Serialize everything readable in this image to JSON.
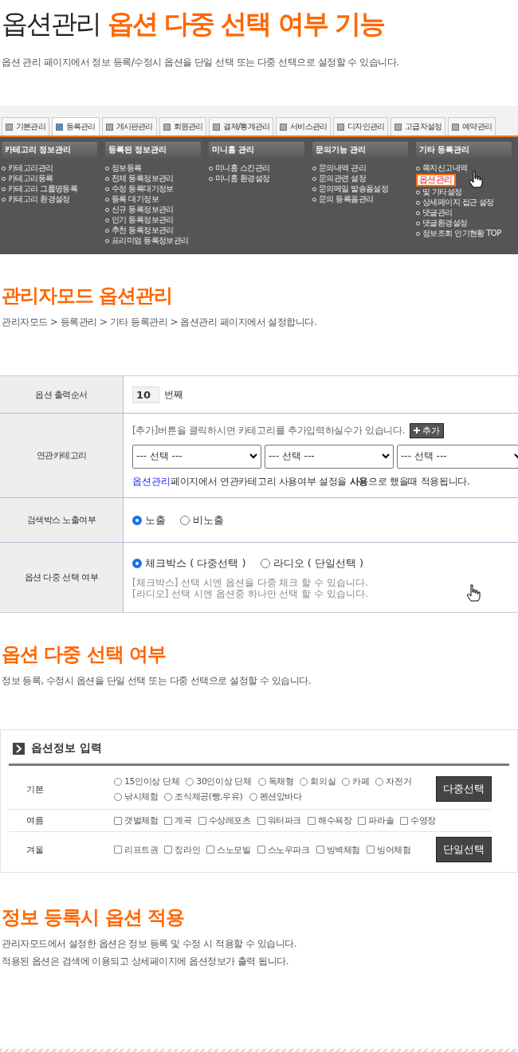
{
  "title": {
    "plain": "옵션관리",
    "accent": "옵션 다중 선택 여부 기능"
  },
  "intro": "옵션 관리 페이지에서 정보 등록/수정시 옵션을 단일 선택 또는 다중 선택으로 설정할 수 있습니다.",
  "admin_menu": {
    "tabs": [
      {
        "label": "기본관리",
        "selected": false
      },
      {
        "label": "등록관리",
        "selected": true
      },
      {
        "label": "게시판관리",
        "selected": false
      },
      {
        "label": "회원관리",
        "selected": false
      },
      {
        "label": "결제/통계관리",
        "selected": false
      },
      {
        "label": "서비스관리",
        "selected": false
      },
      {
        "label": "디자인관리",
        "selected": false
      },
      {
        "label": "고급자설정",
        "selected": false
      },
      {
        "label": "예약관리",
        "selected": false
      }
    ],
    "columns": [
      {
        "heading": "카테고리 정보관리",
        "items": [
          {
            "label": "카테고리관리",
            "selected": false
          },
          {
            "label": "카테고리등록",
            "selected": false
          },
          {
            "label": "카테고리 그룹명등록",
            "selected": false
          },
          {
            "label": "카테고리 환경설정",
            "selected": false
          }
        ]
      },
      {
        "heading": "등록된 정보관리",
        "items": [
          {
            "label": "정보등록",
            "selected": false
          },
          {
            "label": "전체 등록정보관리",
            "selected": false
          },
          {
            "label": "수정 등록대기정보",
            "selected": false
          },
          {
            "label": "등록 대기정보",
            "selected": false
          },
          {
            "label": "신규 등록정보관리",
            "selected": false
          },
          {
            "label": "인기 등록정보관리",
            "selected": false
          },
          {
            "label": "추천 등록정보관리",
            "selected": false
          },
          {
            "label": "프리미엄 등록정보관리",
            "selected": false
          }
        ]
      },
      {
        "heading": "미니홈 관리",
        "items": [
          {
            "label": "미니홈 스킨관리",
            "selected": false
          },
          {
            "label": "미니홈 환경설정",
            "selected": false
          }
        ]
      },
      {
        "heading": "문의기능 관리",
        "items": [
          {
            "label": "문의내역 관리",
            "selected": false
          },
          {
            "label": "문의관련 설정",
            "selected": false
          },
          {
            "label": "문의메일 발송폼설정",
            "selected": false
          },
          {
            "label": "문의 등록폼관리",
            "selected": false
          }
        ]
      },
      {
        "heading": "기타 등록관리",
        "items": [
          {
            "label": "쪽지신고내역",
            "selected": false
          },
          {
            "label": "옵션관리",
            "selected": true
          },
          {
            "label": "및 기타설정",
            "selected": false
          },
          {
            "label": "상세페이지 접근 설정",
            "selected": false
          },
          {
            "label": "댓글관리",
            "selected": false
          },
          {
            "label": "댓글환경설정",
            "selected": false
          },
          {
            "label": "정보조회 인기현황 TOP",
            "selected": false
          }
        ]
      }
    ]
  },
  "section1": {
    "heading": "관리자모드 옵션관리",
    "text": "관리자모드 > 등록관리 > 기타 등록관리 > 옵션관리 페이지에서 설정합니다."
  },
  "settings": [
    {
      "kind": "number",
      "label": "옵션 출력순서",
      "value": "10",
      "unit": "번째"
    },
    {
      "kind": "category",
      "label": "연관카테고리",
      "hint": "[추가]버튼을 클릭하시면 카테고리를 추가입력하실수가 있습니다.",
      "button": "추가",
      "selects": [
        "--- 선택 ---",
        "--- 선택 ---",
        "--- 선택 ---"
      ],
      "note_link": "옵션관리",
      "note": " 페이지에서 연관카테고리 사용여부 설정을 **사용**으로 했을때 적용됩니다."
    },
    {
      "kind": "radio",
      "label": "검색박스 노출여부",
      "options": [
        {
          "label": "노출",
          "selected": true
        },
        {
          "label": "비노출",
          "selected": false
        }
      ]
    },
    {
      "kind": "radio",
      "label": "옵션 다중 선택 여부",
      "options": [
        {
          "label": "체크박스 ( 다중선택 )",
          "selected": true
        },
        {
          "label": "라디오 ( 단일선택 )",
          "selected": false
        }
      ],
      "help": [
        "[체크박스] 선택 시엔 옵션을 다중 체크 할 수 있습니다.",
        "[라디오] 선택 시엔 옵션중 하나만 선택 할 수 있습니다."
      ]
    }
  ],
  "section2": {
    "heading": "옵션 다중 선택 여부",
    "text": "정보 등록, 수정시 옵션을 단일 선택 또는 다중 선택으로 설정할 수 있습니다."
  },
  "option_panel": {
    "title": "옵션정보 입력",
    "groups": [
      {
        "kind": "radio",
        "label": "기본",
        "badge": "다중선택",
        "items": [
          {
            "label": "15인이상 단체",
            "checked": false
          },
          {
            "label": "30인이상 단체",
            "checked": false
          },
          {
            "label": "독채형",
            "checked": false
          },
          {
            "label": "회의실",
            "checked": false
          },
          {
            "label": "카페",
            "checked": false
          },
          {
            "label": "자전거",
            "checked": false
          },
          {
            "label": "낚시체험",
            "checked": false
          },
          {
            "label": "조식제공(빵,우유)",
            "checked": false
          },
          {
            "label": "펜션앞바다",
            "checked": false
          }
        ]
      },
      {
        "kind": "checkbox",
        "label": "여름",
        "items": [
          {
            "label": "갯벌체험",
            "checked": false
          },
          {
            "label": "계곡",
            "checked": false
          },
          {
            "label": "수상레포츠",
            "checked": false
          },
          {
            "label": "워터파크",
            "checked": false
          },
          {
            "label": "해수욕장",
            "checked": false
          },
          {
            "label": "파라솔",
            "checked": false
          },
          {
            "label": "수영장",
            "checked": false
          }
        ]
      },
      {
        "kind": "checkbox",
        "label": "겨울",
        "badge": "단일선택",
        "items": [
          {
            "label": "리프트권",
            "checked": false
          },
          {
            "label": "짚라인",
            "checked": false
          },
          {
            "label": "스노모빌",
            "checked": false
          },
          {
            "label": "스노우파크",
            "checked": false
          },
          {
            "label": "빙벽체험",
            "checked": false
          },
          {
            "label": "빙어체험",
            "checked": false
          }
        ]
      }
    ]
  },
  "section3": {
    "heading": "정보 등록시 옵션 적용",
    "lines": [
      "관리자모드에서 설정한 옵션은 정보 등록 및 수정 시 적용할 수 있습니다.",
      "적용된 옵션은 검색에 이용되고 상세페이지에 옵션정보가 출력 됩니다."
    ]
  }
}
